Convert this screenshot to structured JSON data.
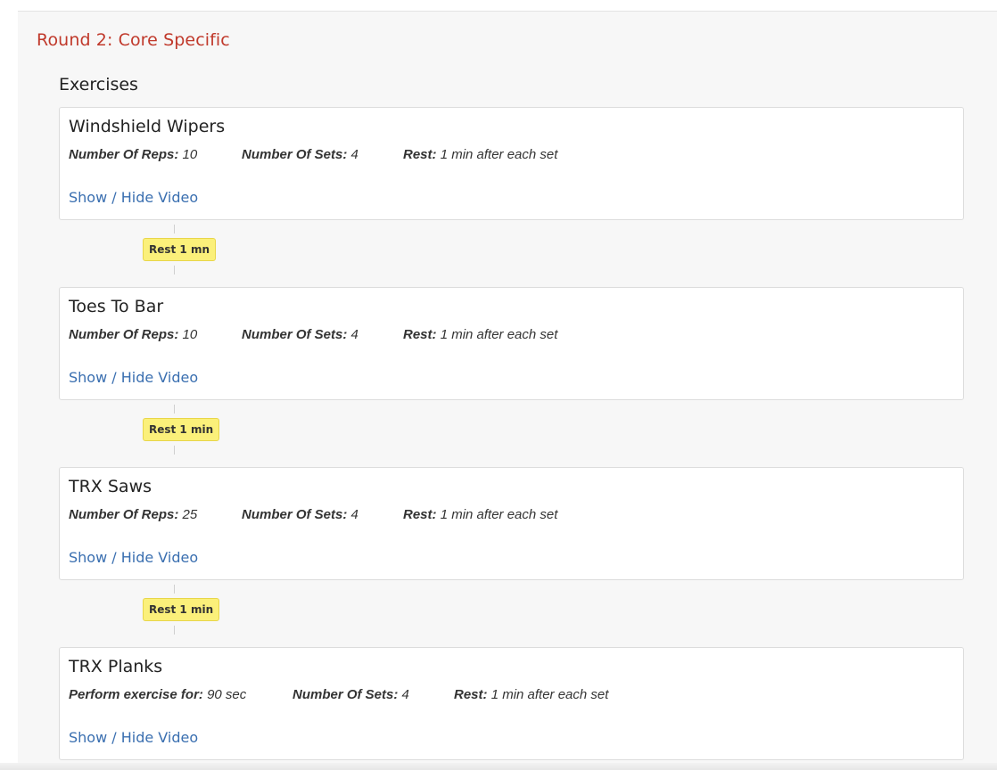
{
  "round": {
    "title": "Round 2: Core Specific"
  },
  "section": {
    "title": "Exercises"
  },
  "exercises": [
    {
      "title": "Windshield Wipers",
      "fields": [
        {
          "key": "Number Of Reps:",
          "value": "10"
        },
        {
          "key": "Number Of Sets:",
          "value": "4"
        },
        {
          "key": "Rest:",
          "value": "1 min after each set"
        }
      ],
      "link": "Show / Hide Video"
    },
    {
      "title": "Toes To Bar",
      "fields": [
        {
          "key": "Number Of Reps:",
          "value": "10"
        },
        {
          "key": "Number Of Sets:",
          "value": "4"
        },
        {
          "key": "Rest:",
          "value": "1 min after each set"
        }
      ],
      "link": "Show / Hide Video"
    },
    {
      "title": "TRX Saws",
      "fields": [
        {
          "key": "Number Of Reps:",
          "value": "25"
        },
        {
          "key": "Number Of Sets:",
          "value": "4"
        },
        {
          "key": "Rest:",
          "value": "1 min after each set"
        }
      ],
      "link": "Show / Hide Video"
    },
    {
      "title": "TRX Planks",
      "fields": [
        {
          "key": "Perform exercise for:",
          "value": "90 sec"
        },
        {
          "key": "Number Of Sets:",
          "value": "4"
        },
        {
          "key": "Rest:",
          "value": "1 min after each set"
        }
      ],
      "link": "Show / Hide Video"
    }
  ],
  "rests": [
    "Rest 1 mn",
    "Rest 1 min",
    "Rest 1 min"
  ],
  "colors": {
    "round_title": "#c0392b",
    "link": "#3a6fb0",
    "badge_bg": "#fbf07a",
    "badge_border": "#e8d64a"
  }
}
